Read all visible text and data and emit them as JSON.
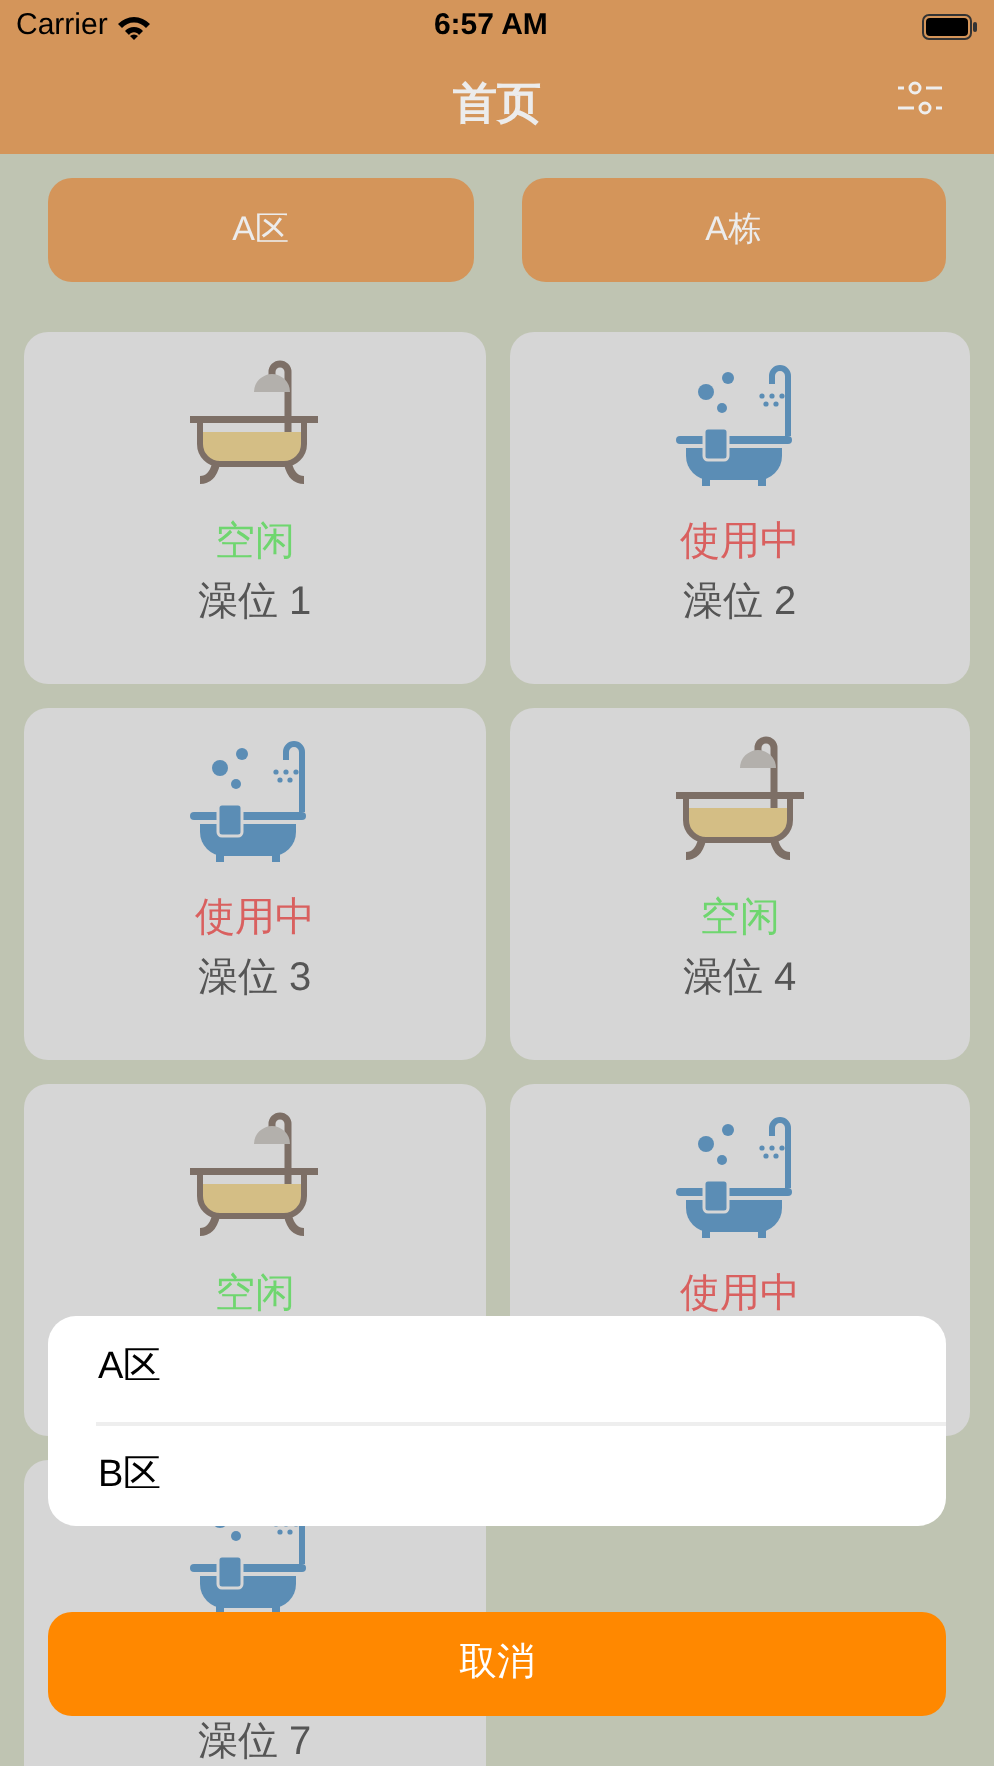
{
  "status_bar": {
    "carrier": "Carrier",
    "time": "6:57 AM"
  },
  "nav": {
    "title": "首页"
  },
  "filters": [
    {
      "label": "A区"
    },
    {
      "label": "A栋"
    }
  ],
  "stalls": [
    {
      "kind": "free",
      "status": "空闲",
      "name": "澡位 1"
    },
    {
      "kind": "busy",
      "status": "使用中",
      "name": "澡位 2"
    },
    {
      "kind": "busy",
      "status": "使用中",
      "name": "澡位 3"
    },
    {
      "kind": "free",
      "status": "空闲",
      "name": "澡位 4"
    },
    {
      "kind": "free",
      "status": "空闲"
    },
    {
      "kind": "busy",
      "status": "使用中"
    },
    {
      "kind": "busy",
      "name": "澡位 7"
    }
  ],
  "action_sheet": {
    "options": [
      {
        "label": "A区"
      },
      {
        "label": "B区"
      }
    ],
    "cancel": "取消"
  }
}
